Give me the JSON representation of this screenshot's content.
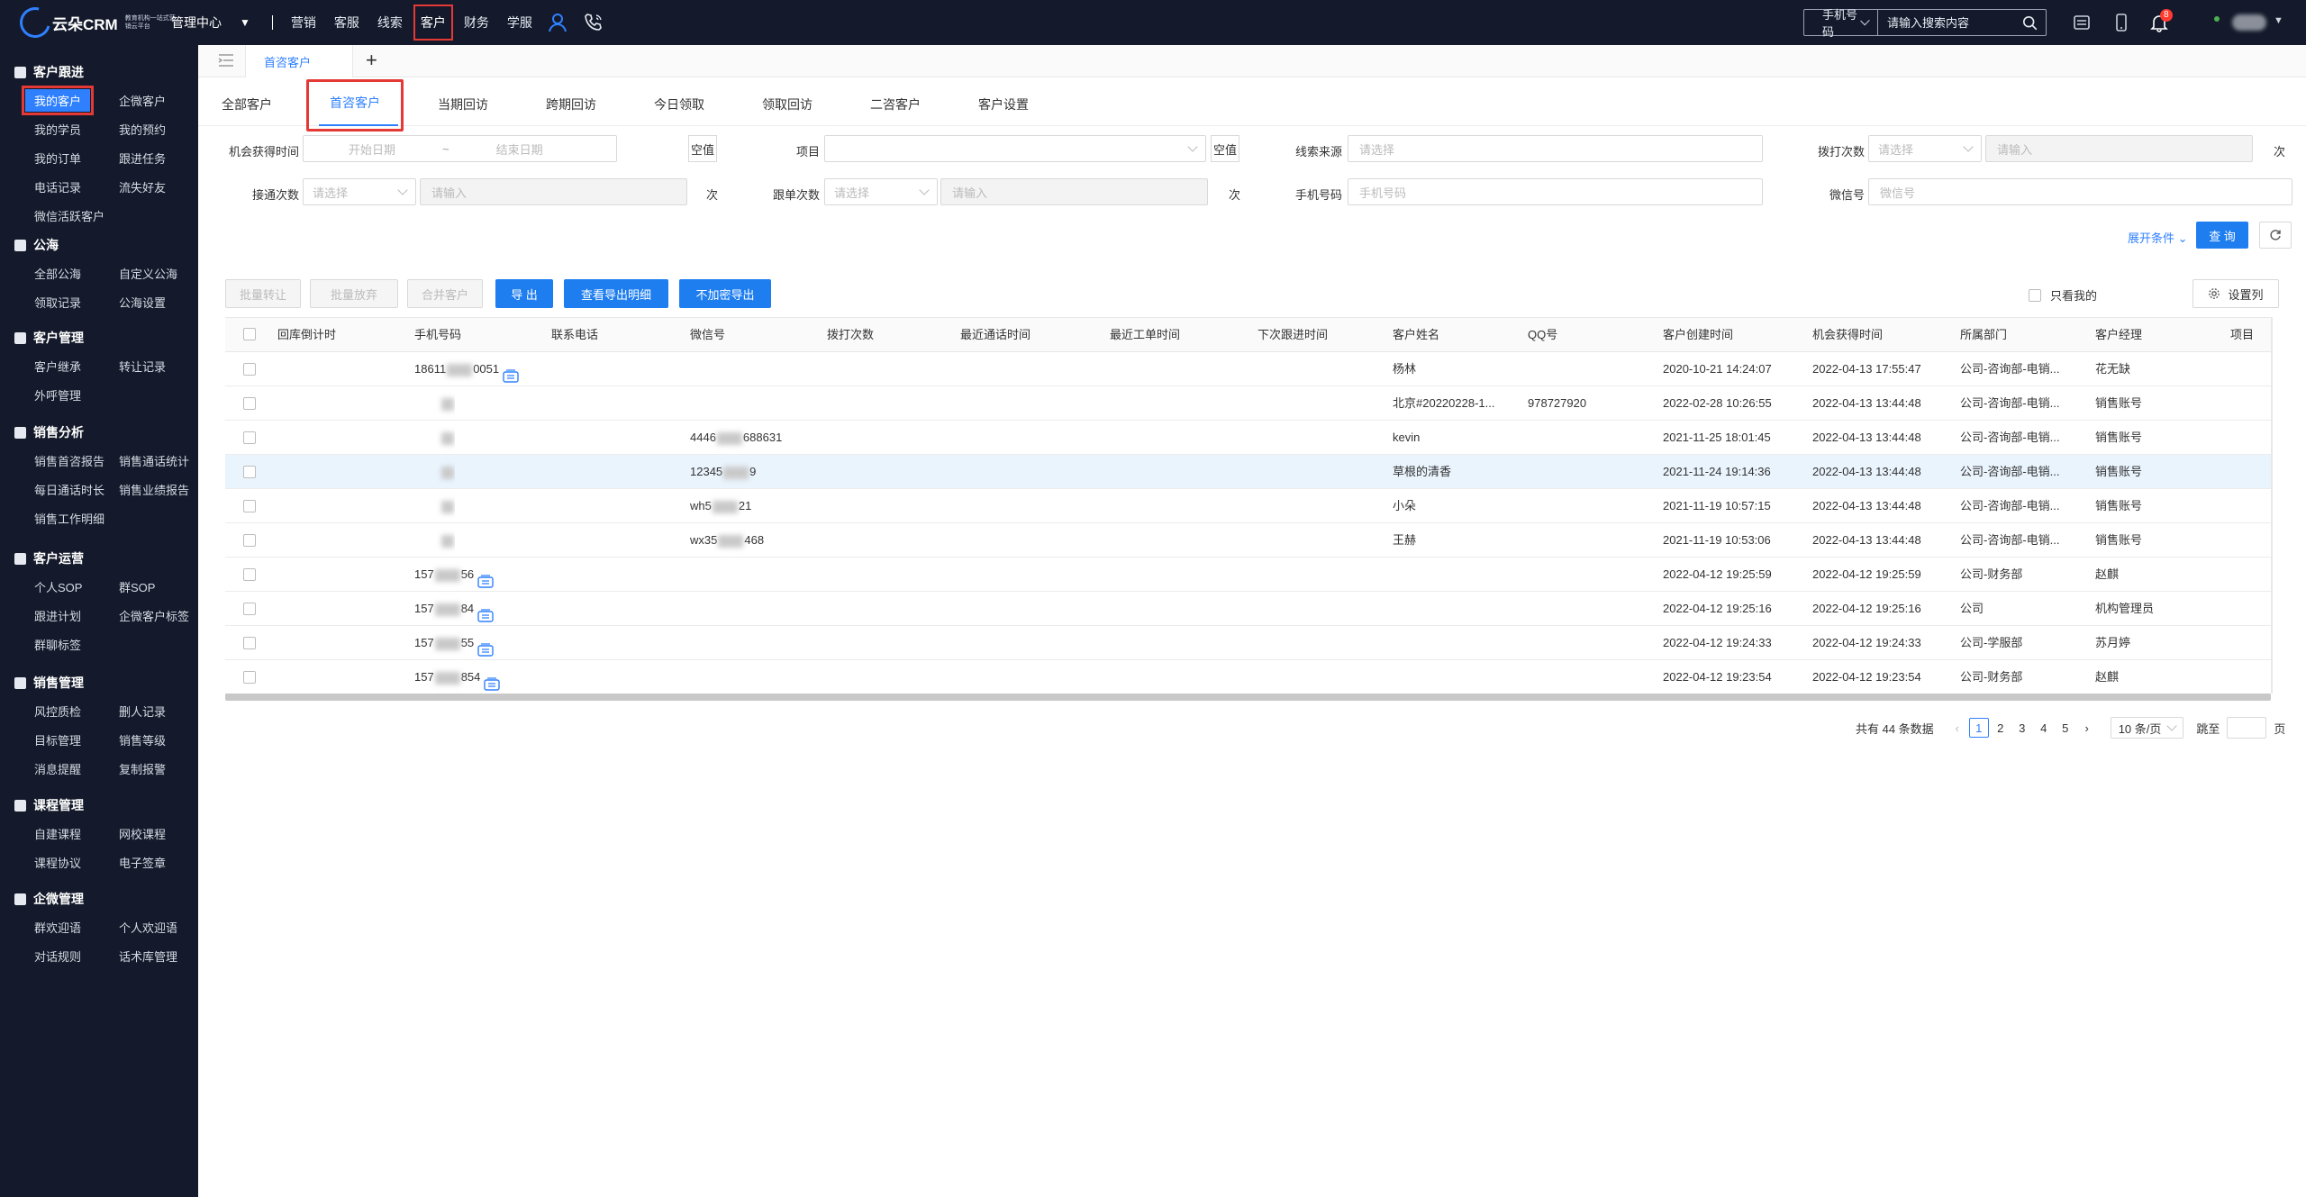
{
  "topbar": {
    "logo_text": "云朵CRM",
    "logo_sub": "教育机构一站式营销云平台",
    "mgmt_center": "管理中心",
    "nav": [
      "营销",
      "客服",
      "线索",
      "客户",
      "财务",
      "学服"
    ],
    "active_nav": "客户",
    "search_type": "手机号码",
    "search_placeholder": "请输入搜索内容",
    "bell_count": "8"
  },
  "sidebar": {
    "sections": [
      {
        "title": "客户跟进",
        "items": [
          "我的客户",
          "企微客户",
          "我的学员",
          "我的预约",
          "我的订单",
          "跟进任务",
          "电话记录",
          "流失好友",
          "微信活跃客户"
        ]
      },
      {
        "title": "公海",
        "items": [
          "全部公海",
          "自定义公海",
          "领取记录",
          "公海设置"
        ]
      },
      {
        "title": "客户管理",
        "items": [
          "客户继承",
          "转让记录",
          "外呼管理"
        ]
      },
      {
        "title": "销售分析",
        "items": [
          "销售首咨报告",
          "销售通话统计",
          "每日通话时长",
          "销售业绩报告",
          "销售工作明细"
        ]
      },
      {
        "title": "客户运营",
        "items": [
          "个人SOP",
          "群SOP",
          "跟进计划",
          "企微客户标签",
          "群聊标签"
        ]
      },
      {
        "title": "销售管理",
        "items": [
          "风控质检",
          "删人记录",
          "目标管理",
          "销售等级",
          "消息提醒",
          "复制报警"
        ]
      },
      {
        "title": "课程管理",
        "items": [
          "自建课程",
          "网校课程",
          "课程协议",
          "电子签章"
        ]
      },
      {
        "title": "企微管理",
        "items": [
          "群欢迎语",
          "个人欢迎语",
          "对话规则",
          "话术库管理"
        ]
      }
    ]
  },
  "tabs": {
    "active": "首咨客户",
    "add": "+"
  },
  "subtabs": [
    "全部客户",
    "首咨客户",
    "当期回访",
    "跨期回访",
    "今日领取",
    "领取回访",
    "二咨客户",
    "客户设置"
  ],
  "filters": {
    "opp_time_label": "机会获得时间",
    "start_placeholder": "开始日期",
    "range_sep": "~",
    "end_placeholder": "结束日期",
    "empty_btn": "空值",
    "project_label": "项目",
    "lead_source_label": "线索来源",
    "lead_source_placeholder": "请选择",
    "dial_count_label": "拨打次数",
    "select_placeholder": "请选择",
    "input_placeholder": "请输入",
    "unit": "次",
    "connect_count_label": "接通次数",
    "followup_count_label": "跟单次数",
    "phone_label": "手机号码",
    "phone_placeholder": "手机号码",
    "wechat_label": "微信号",
    "wechat_placeholder": "微信号",
    "expand": "展开条件",
    "query": "查 询"
  },
  "actions": {
    "batch_transfer": "批量转让",
    "batch_release": "批量放弃",
    "merge": "合并客户",
    "export": "导 出",
    "export_detail": "查看导出明细",
    "export_plain": "不加密导出",
    "only_mine": "只看我的",
    "set_columns": "设置列"
  },
  "table": {
    "headers": [
      "回库倒计时",
      "手机号码",
      "联系电话",
      "微信号",
      "拨打次数",
      "最近通话时间",
      "最近工单时间",
      "下次跟进时间",
      "客户姓名",
      "QQ号",
      "客户创建时间",
      "机会获得时间",
      "所属部门",
      "客户经理",
      "项目"
    ],
    "rows": [
      {
        "phone_a": "18611",
        "phone_b": "0051",
        "wechat_a": "",
        "wechat_b": "",
        "name": "杨林",
        "qq": "",
        "created": "2020-10-21 14:24:07",
        "opp": "2022-04-13 17:55:47",
        "dept": "公司-咨询部-电销...",
        "manager": "花无缺"
      },
      {
        "phone_a": "",
        "phone_b": "",
        "wechat_a": "",
        "wechat_b": "",
        "name": "北京#20220228-1...",
        "qq": "978727920",
        "created": "2022-02-28 10:26:55",
        "opp": "2022-04-13 13:44:48",
        "dept": "公司-咨询部-电销...",
        "manager": "销售账号"
      },
      {
        "phone_a": "",
        "phone_b": "",
        "wechat_a": "4446",
        "wechat_b": "688631",
        "name": "kevin",
        "qq": "",
        "created": "2021-11-25 18:01:45",
        "opp": "2022-04-13 13:44:48",
        "dept": "公司-咨询部-电销...",
        "manager": "销售账号"
      },
      {
        "phone_a": "",
        "phone_b": "",
        "wechat_a": "12345",
        "wechat_b": "9",
        "name": "草根的清香",
        "qq": "",
        "created": "2021-11-24 19:14:36",
        "opp": "2022-04-13 13:44:48",
        "dept": "公司-咨询部-电销...",
        "manager": "销售账号"
      },
      {
        "phone_a": "",
        "phone_b": "",
        "wechat_a": "wh5",
        "wechat_b": "21",
        "name": "小朵",
        "qq": "",
        "created": "2021-11-19 10:57:15",
        "opp": "2022-04-13 13:44:48",
        "dept": "公司-咨询部-电销...",
        "manager": "销售账号"
      },
      {
        "phone_a": "",
        "phone_b": "",
        "wechat_a": "wx35",
        "wechat_b": "468",
        "name": "王赫",
        "qq": "",
        "created": "2021-11-19 10:53:06",
        "opp": "2022-04-13 13:44:48",
        "dept": "公司-咨询部-电销...",
        "manager": "销售账号"
      },
      {
        "phone_a": "157",
        "phone_b": "56",
        "wechat_a": "",
        "wechat_b": "",
        "name": "",
        "qq": "",
        "created": "2022-04-12 19:25:59",
        "opp": "2022-04-12 19:25:59",
        "dept": "公司-财务部",
        "manager": "赵麒"
      },
      {
        "phone_a": "157",
        "phone_b": "84",
        "wechat_a": "",
        "wechat_b": "",
        "name": "",
        "qq": "",
        "created": "2022-04-12 19:25:16",
        "opp": "2022-04-12 19:25:16",
        "dept": "公司",
        "manager": "机构管理员"
      },
      {
        "phone_a": "157",
        "phone_b": "55",
        "wechat_a": "",
        "wechat_b": "",
        "name": "",
        "qq": "",
        "created": "2022-04-12 19:24:33",
        "opp": "2022-04-12 19:24:33",
        "dept": "公司-学服部",
        "manager": "苏月婷"
      },
      {
        "phone_a": "157",
        "phone_b": "854",
        "wechat_a": "",
        "wechat_b": "",
        "name": "",
        "qq": "",
        "created": "2022-04-12 19:23:54",
        "opp": "2022-04-12 19:23:54",
        "dept": "公司-财务部",
        "manager": "赵麒"
      }
    ]
  },
  "pager": {
    "total": "共有 44 条数据",
    "pages": [
      "1",
      "2",
      "3",
      "4",
      "5"
    ],
    "active": "1",
    "size": "10 条/页",
    "jump_label": "跳至",
    "page_unit": "页"
  },
  "colors": {
    "primary": "#1e7ef0",
    "sidebar_bg": "#141a2b",
    "highlight_box": "#e53935",
    "row_highlight": "#eaf4fd"
  }
}
